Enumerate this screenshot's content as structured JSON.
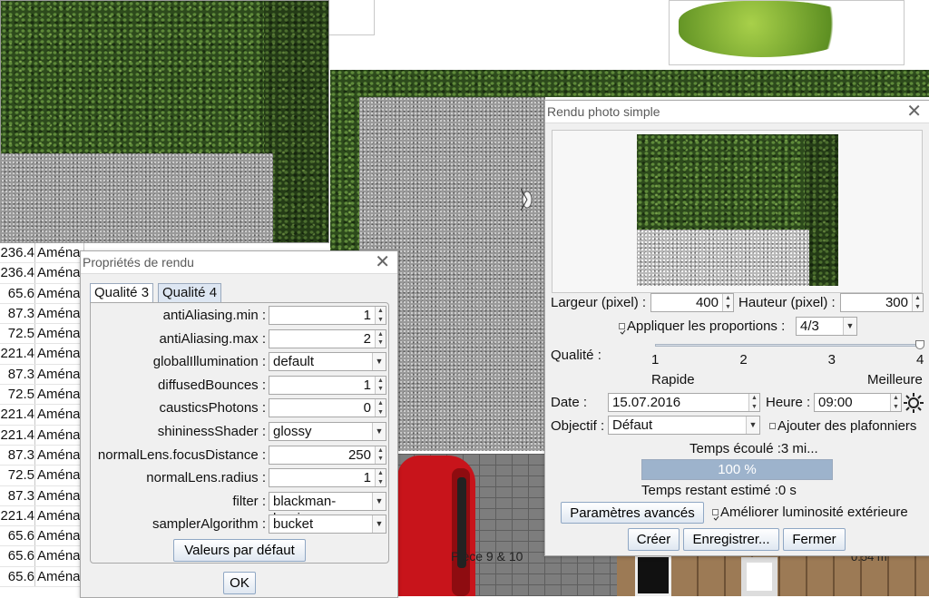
{
  "background": {
    "scene_label": "Pièce 9 & 10",
    "dimension_label": "0.54 m",
    "table_rows": [
      {
        "size": "236.4",
        "name": "Aména"
      },
      {
        "size": "236.4",
        "name": "Aména"
      },
      {
        "size": "65.6",
        "name": "Aména"
      },
      {
        "size": "87.3",
        "name": "Aména"
      },
      {
        "size": "72.5",
        "name": "Aména"
      },
      {
        "size": "221.4",
        "name": "Aména"
      },
      {
        "size": "87.3",
        "name": "Aména"
      },
      {
        "size": "72.5",
        "name": "Aména"
      },
      {
        "size": "221.4",
        "name": "Aména"
      },
      {
        "size": "221.4",
        "name": "Aména"
      },
      {
        "size": "87.3",
        "name": "Aména"
      },
      {
        "size": "72.5",
        "name": "Aména"
      },
      {
        "size": "87.3",
        "name": "Aména"
      },
      {
        "size": "221.4",
        "name": "Aména"
      },
      {
        "size": "65.6",
        "name": "Aména"
      },
      {
        "size": "65.6",
        "name": "Aména"
      },
      {
        "size": "65.6",
        "name": "Aména"
      }
    ]
  },
  "render_props": {
    "title": "Propriétés de rendu",
    "tabs": [
      "Qualité 3",
      "Qualité 4"
    ],
    "rows": [
      {
        "label": "antiAliasing.min :",
        "value": "1",
        "kind": "spin"
      },
      {
        "label": "antiAliasing.max :",
        "value": "2",
        "kind": "spin"
      },
      {
        "label": "globalIllumination :",
        "value": "default",
        "kind": "combo"
      },
      {
        "label": "diffusedBounces :",
        "value": "1",
        "kind": "spin"
      },
      {
        "label": "causticsPhotons :",
        "value": "0",
        "kind": "spin"
      },
      {
        "label": "shininessShader :",
        "value": "glossy",
        "kind": "combo"
      },
      {
        "label": "normalLens.focusDistance :",
        "value": "250",
        "kind": "spin"
      },
      {
        "label": "normalLens.radius :",
        "value": "1",
        "kind": "spin"
      },
      {
        "label": "filter :",
        "value": "blackman-harris",
        "kind": "combo"
      },
      {
        "label": "samplerAlgorithm :",
        "value": "bucket",
        "kind": "combo"
      }
    ],
    "defaults_button": "Valeurs par défaut",
    "ok_button": "OK"
  },
  "photo": {
    "title": "Rendu photo simple",
    "width_label": "Largeur (pixel) :",
    "width_value": "400",
    "height_label": "Hauteur (pixel) :",
    "height_value": "300",
    "keep_proportions_label": "Appliquer les proportions :",
    "keep_proportions_checked": true,
    "proportions_value": "4/3",
    "quality_label": "Qualité :",
    "quality_ticks": [
      "1",
      "2",
      "3",
      "4"
    ],
    "quality_level": 4,
    "quality_min_label": "Rapide",
    "quality_max_label": "Meilleure",
    "date_label": "Date :",
    "date_value": "15.07.2016",
    "time_label": "Heure :",
    "time_value": "09:00",
    "lens_label": "Objectif :",
    "lens_value": "Défaut",
    "ceiling_lights_label": "Ajouter des plafonniers",
    "elapsed_label": "Temps écoulé :3 mi...",
    "progress_text": "100 %",
    "progress": 1.0,
    "remaining_label": "Temps restant estimé :0 s",
    "advanced_button": "Paramètres avancés",
    "improve_light_label": "Améliorer luminosité extérieure",
    "improve_light_checked": true,
    "create_button": "Créer",
    "save_button": "Enregistrer...",
    "close_button": "Fermer"
  },
  "colors": {
    "accent": "#8fa7c4",
    "progress_fill": "#9db3cc",
    "tab_active": "#dde6f2"
  }
}
